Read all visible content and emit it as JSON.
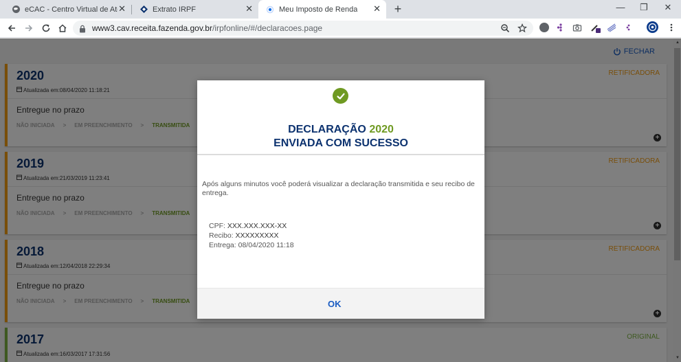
{
  "browser": {
    "tabs": [
      {
        "title": "eCAC - Centro Virtual de Atendimento",
        "favicon": "globe-icon"
      },
      {
        "title": "Extrato IRPF",
        "favicon": "receita-icon"
      },
      {
        "title": "Meu Imposto de Renda",
        "favicon": "loading-icon",
        "active": true
      }
    ],
    "new_tab": "+",
    "url_host": "www3.cav.receita.fazenda.gov.br",
    "url_path": "/irpfonline/#/declaracoes.page"
  },
  "page": {
    "fechar_label": "FECHAR",
    "cards": [
      {
        "year": "2020",
        "updated": "Atualizada em:08/04/2020 11:18:21",
        "type": "RETIFICADORA",
        "status": "Entregue no prazo",
        "steps": [
          "NÃO INICIADA",
          "EM PREENCHIMENTO",
          "TRANSMITIDA"
        ]
      },
      {
        "year": "2019",
        "updated": "Atualizada em:21/03/2019 11:23:41",
        "type": "RETIFICADORA",
        "status": "Entregue no prazo",
        "steps": [
          "NÃO INICIADA",
          "EM PREENCHIMENTO",
          "TRANSMITIDA"
        ]
      },
      {
        "year": "2018",
        "updated": "Atualizada em:12/04/2018 22:29:34",
        "type": "RETIFICADORA",
        "status": "Entregue no prazo",
        "steps": [
          "NÃO INICIADA",
          "EM PREENCHIMENTO",
          "TRANSMITIDA"
        ]
      },
      {
        "year": "2017",
        "updated": "Atualizada em:16/03/2017 17:31:56",
        "type": "ORIGINAL"
      }
    ],
    "step_separator": ">"
  },
  "modal": {
    "heading_line1": "DECLARAÇÃO",
    "heading_year": "2020",
    "heading_line2": "ENVIADA COM SUCESSO",
    "message": "Após alguns minutos você poderá visualizar a declaração transmitida e seu recibo de entrega.",
    "cpf_label": "CPF:",
    "cpf_value": "XXX.XXX.XXX-XX",
    "recibo_label": "Recibo:",
    "recibo_value": "XXXXXXXXX",
    "entrega_label": "Entrega:",
    "entrega_value": "08/04/2020 11:18",
    "ok_label": "OK"
  },
  "colors": {
    "navy": "#0c326f",
    "green": "#6f9a22",
    "orange": "#f39c12",
    "link_blue": "#1a5cc2"
  }
}
